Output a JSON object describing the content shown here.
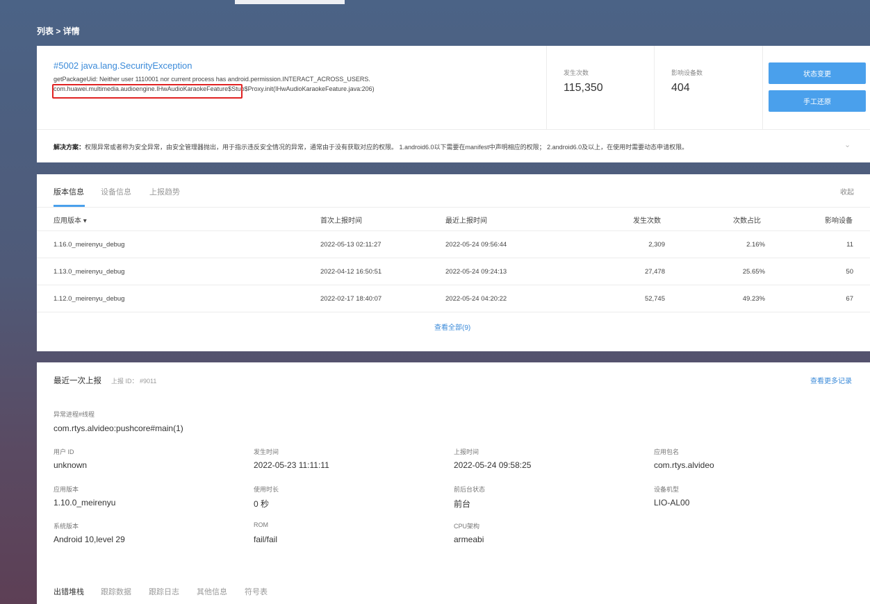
{
  "breadcrumb": "列表 > 详情",
  "exception": {
    "title": "#5002 java.lang.SecurityException",
    "line1": "getPackageUid: Neither user 1110001 nor current process has android.permission.INTERACT_ACROSS_USERS.",
    "line2": "com.huawei.multimedia.audioengine.IHwAudioKaraokeFeature$Stub$Proxy.init(IHwAudioKaraokeFeature.java:206)"
  },
  "stats": {
    "occurrences_label": "发生次数",
    "occurrences_value": "115,350",
    "devices_label": "影响设备数",
    "devices_value": "404"
  },
  "actions": {
    "status_change": "状态变更",
    "manual_restore": "手工还原"
  },
  "solution": {
    "label": "解决方案：",
    "text": "权限异常或者称为安全异常，由安全管理器抛出，用于指示违反安全情况的异常，通常由于没有获取对应的权限。 1.android6.0以下需要在manifest中声明相应的权限； 2.android6.0及以上，在使用时需要动态申请权限。",
    "chevron": "chevron-down-icon"
  },
  "version_card": {
    "tabs": [
      "版本信息",
      "设备信息",
      "上报趋势"
    ],
    "active_tab": 0,
    "collapse": "收起",
    "columns": [
      "应用版本 ▾",
      "首次上报时间",
      "最近上报时间",
      "发生次数",
      "次数占比",
      "影响设备"
    ],
    "rows": [
      [
        "1.16.0_meirenyu_debug",
        "2022-05-13 02:11:27",
        "2022-05-24 09:56:44",
        "2,309",
        "2.16%",
        "11"
      ],
      [
        "1.13.0_meirenyu_debug",
        "2022-04-12 16:50:51",
        "2022-05-24 09:24:13",
        "27,478",
        "25.65%",
        "50"
      ],
      [
        "1.12.0_meirenyu_debug",
        "2022-02-17 18:40:07",
        "2022-05-24 04:20:22",
        "52,745",
        "49.23%",
        "67"
      ]
    ],
    "view_all": "查看全部(9)"
  },
  "last_report": {
    "title": "最近一次上报",
    "id_label": "上报 ID： #9011",
    "more_records": "查看更多记录",
    "process_label": "异常进程#线程",
    "process_value": "com.rtys.alvideo:pushcore#main(1)",
    "fields": [
      {
        "label": "用户 ID",
        "value": "unknown"
      },
      {
        "label": "发生时间",
        "value": "2022-05-23 11:11:11"
      },
      {
        "label": "上报时间",
        "value": "2022-05-24 09:58:25"
      },
      {
        "label": "应用包名",
        "value": "com.rtys.alvideo"
      },
      {
        "label": "应用版本",
        "value": "1.10.0_meirenyu"
      },
      {
        "label": "使用时长",
        "value": "0 秒"
      },
      {
        "label": "前后台状态",
        "value": "前台"
      },
      {
        "label": "设备机型",
        "value": "LIO-AL00"
      },
      {
        "label": "系统版本",
        "value": "Android 10,level 29"
      },
      {
        "label": "ROM",
        "value": "fail/fail"
      },
      {
        "label": "CPU架构",
        "value": "armeabi"
      }
    ],
    "bottom_tabs": [
      "出错堆栈",
      "跟踪数据",
      "跟踪日志",
      "其他信息",
      "符号表"
    ],
    "active_bottom_tab": 0
  },
  "colors": {
    "accent": "#4aa0ec",
    "link": "#3c8bd9",
    "highlight_box": "#e02222"
  }
}
